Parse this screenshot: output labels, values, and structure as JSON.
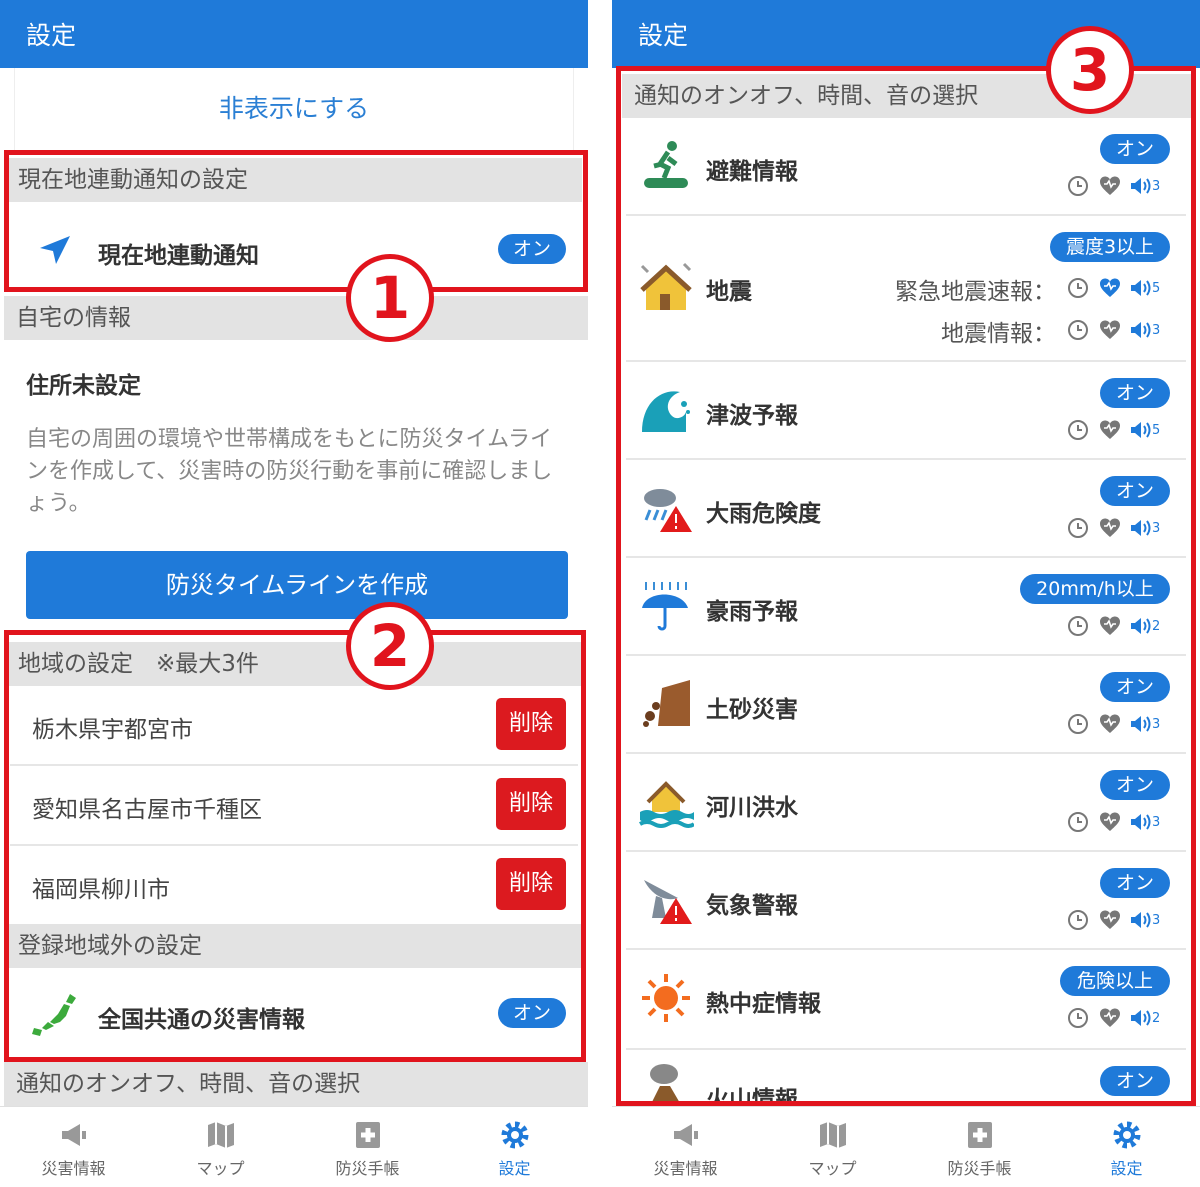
{
  "left": {
    "title": "設定",
    "hide_link": "非表示にする",
    "location_section": "現在地連動通知の設定",
    "location_item": "現在地連動通知",
    "location_state": "オン",
    "home_section": "自宅の情報",
    "address_status": "住所未設定",
    "description": "自宅の周囲の環境や世帯構成をもとに防災タイムラインを作成して、災害時の防災行動を事前に確認しましょう。",
    "timeline_button": "防災タイムラインを作成",
    "region_section": "地域の設定　※最大3件",
    "regions": [
      {
        "name": "栃木県宇都宮市",
        "delete": "削除"
      },
      {
        "name": "愛知県名古屋市千種区",
        "delete": "削除"
      },
      {
        "name": "福岡県柳川市",
        "delete": "削除"
      }
    ],
    "outside_section": "登録地域外の設定",
    "national_item": "全国共通の災害情報",
    "national_state": "オン",
    "notify_section": "通知のオンオフ、時間、音の選択",
    "badge1": "1",
    "badge2": "2"
  },
  "right": {
    "title": "設定",
    "notify_section": "通知のオンオフ、時間、音の選択",
    "badge3": "3",
    "items": [
      {
        "title": "避難情報",
        "state": "オン",
        "sound": "3"
      },
      {
        "title": "地震",
        "state": "震度3以上",
        "sub": [
          {
            "label": "緊急地震速報：",
            "sound": "5"
          },
          {
            "label": "地震情報：",
            "sound": "3"
          }
        ]
      },
      {
        "title": "津波予報",
        "state": "オン",
        "sound": "5"
      },
      {
        "title": "大雨危険度",
        "state": "オン",
        "sound": "3"
      },
      {
        "title": "豪雨予報",
        "state": "20mm/h以上",
        "sound": "2"
      },
      {
        "title": "土砂災害",
        "state": "オン",
        "sound": "3"
      },
      {
        "title": "河川洪水",
        "state": "オン",
        "sound": "3"
      },
      {
        "title": "気象警報",
        "state": "オン",
        "sound": "3"
      },
      {
        "title": "熱中症情報",
        "state": "危険以上",
        "sound": "2"
      },
      {
        "title": "火山情報",
        "state": "オン"
      }
    ]
  },
  "tabs": [
    {
      "label": "災害情報",
      "icon": "megaphone-icon"
    },
    {
      "label": "マップ",
      "icon": "map-icon"
    },
    {
      "label": "防災手帳",
      "icon": "first-aid-notebook-icon"
    },
    {
      "label": "設定",
      "icon": "gear-icon"
    }
  ],
  "colors": {
    "primary": "#1f7ad9",
    "delete": "#dc1a1f",
    "frame": "#e1141d",
    "section_bg": "#e3e3e3"
  }
}
